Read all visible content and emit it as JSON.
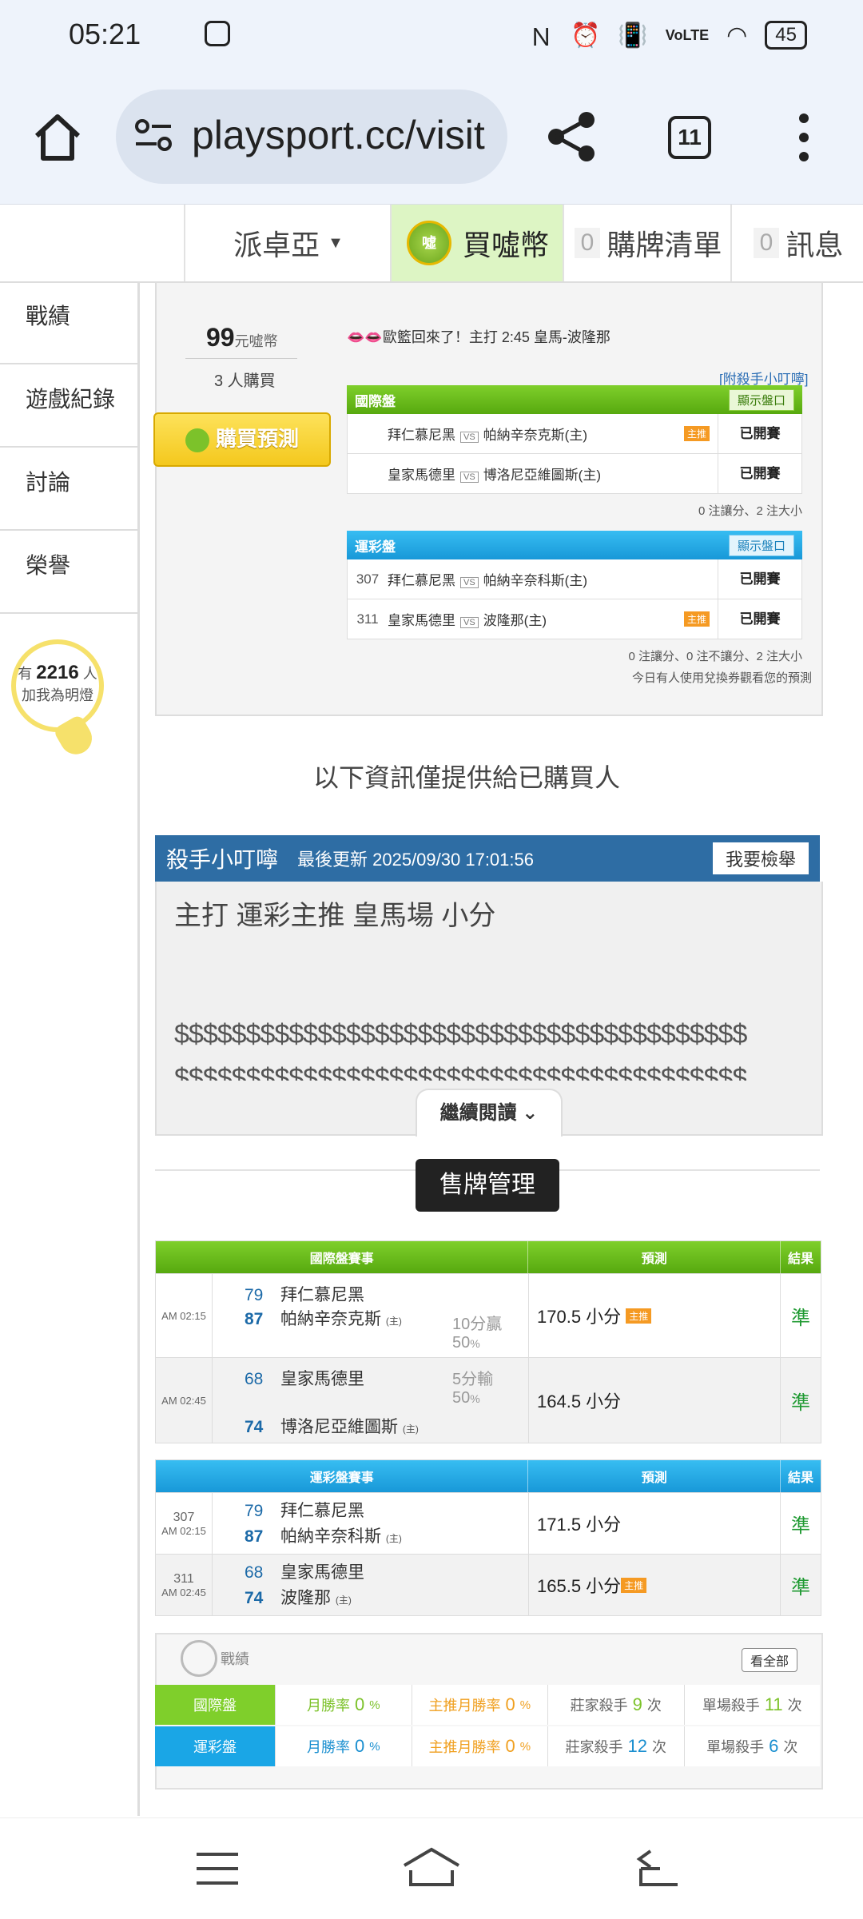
{
  "status_bar": {
    "time": "05:21",
    "battery": "45"
  },
  "browser": {
    "url": "playsport.cc/visit",
    "tab_count": "11"
  },
  "site_bar": {
    "user": "派卓亞",
    "coin_label": "買噓幣",
    "cart_count": "0",
    "cart_label": "購牌清單",
    "msg_count": "0",
    "msg_label": "訊息"
  },
  "left_nav": {
    "items": [
      "戰績",
      "遊戲紀錄",
      "討論",
      "榮譽"
    ],
    "followers_prefix": "有",
    "followers_count": "2216",
    "followers_suffix": "人",
    "followers_action": "加我為明燈"
  },
  "panel": {
    "price": "99",
    "price_unit": "元噓幣",
    "buyers": "3 人購買",
    "buy_label": "購買預測",
    "notice": "👄👄歐籃回來了！主打 2:45 皇馬-波隆那",
    "tip_link": "[附殺手小叮嚀]",
    "intl": {
      "title": "國際盤",
      "toggle": "顯示盤口",
      "rows": [
        {
          "home": "拜仁慕尼黑",
          "away": "帕納辛奈克斯(主)",
          "tag": "主推",
          "status": "已開賽"
        },
        {
          "home": "皇家馬德里",
          "away": "博洛尼亞維圖斯(主)",
          "tag": "",
          "status": "已開賽"
        }
      ],
      "note": "0 注讓分、2 注大小"
    },
    "lottery": {
      "title": "運彩盤",
      "toggle": "顯示盤口",
      "rows": [
        {
          "no": "307",
          "home": "拜仁慕尼黑",
          "away": "帕納辛奈科斯(主)",
          "tag": "",
          "status": "已開賽"
        },
        {
          "no": "311",
          "home": "皇家馬德里",
          "away": "波隆那(主)",
          "tag": "主推",
          "status": "已開賽"
        }
      ],
      "note": "0 注讓分、0 注不讓分、2 注大小",
      "note2": "今日有人使用兌換券觀看您的預測"
    },
    "vs": "VS"
  },
  "buyer_only": "以下資訊僅提供給已購買人",
  "tip": {
    "title": "殺手小叮嚀",
    "updated": "最後更新 2025/09/30 17:01:56",
    "report": "我要檢舉",
    "main": "主打 運彩主推 皇馬場  小分",
    "dollars": "$$$$$$$$$$$$$$$$$$$$$$$$$$$$$$$$$$$$$$$$",
    "continue": "繼續閱讀"
  },
  "sell_label": "售牌管理",
  "results_intl": {
    "h_match": "國際盤賽事",
    "h_pred": "預測",
    "h_res": "結果",
    "rows": [
      {
        "time": "AM 02:15",
        "s1": "79",
        "t1": "拜仁慕尼黑",
        "s2": "87",
        "t2": "帕納辛奈克斯",
        "spread": "10分贏",
        "pct": "50",
        "pred": "170.5 小分",
        "tag": "主推",
        "res": "準"
      },
      {
        "time": "AM 02:45",
        "s1": "68",
        "t1": "皇家馬德里",
        "s2": "74",
        "t2": "博洛尼亞維圖斯",
        "spread": "5分輸",
        "pct": "50",
        "pred": "164.5 小分",
        "tag": "",
        "res": "準"
      }
    ]
  },
  "results_lottery": {
    "h_match": "運彩盤賽事",
    "h_pred": "預測",
    "h_res": "結果",
    "rows": [
      {
        "no": "307",
        "time": "AM 02:15",
        "s1": "79",
        "t1": "拜仁慕尼黑",
        "s2": "87",
        "t2": "帕納辛奈科斯",
        "pred": "171.5 小分",
        "tag": "",
        "res": "準"
      },
      {
        "no": "311",
        "time": "AM 02:45",
        "s1": "68",
        "t1": "皇家馬德里",
        "s2": "74",
        "t2": "波隆那",
        "pred": "165.5 小分",
        "tag": "主推",
        "res": "準"
      }
    ]
  },
  "home_mark": "主",
  "pct_sign": "%",
  "stats": {
    "title": "戰績",
    "see_all": "看全部",
    "rows": [
      {
        "label": "國際盤",
        "month_label": "月勝率",
        "month": "0",
        "main_label": "主推月勝率",
        "main": "0",
        "dealer_label": "莊家殺手",
        "dealer": "9",
        "single_label": "單場殺手",
        "single": "11"
      },
      {
        "label": "運彩盤",
        "month_label": "月勝率",
        "month": "0",
        "main_label": "主推月勝率",
        "main": "0",
        "dealer_label": "莊家殺手",
        "dealer": "12",
        "single_label": "單場殺手",
        "single": "6"
      }
    ],
    "times": "次"
  },
  "colors": {
    "green": "#57a90f",
    "blue": "#1898d8",
    "tip_blue": "#2e6da4"
  }
}
